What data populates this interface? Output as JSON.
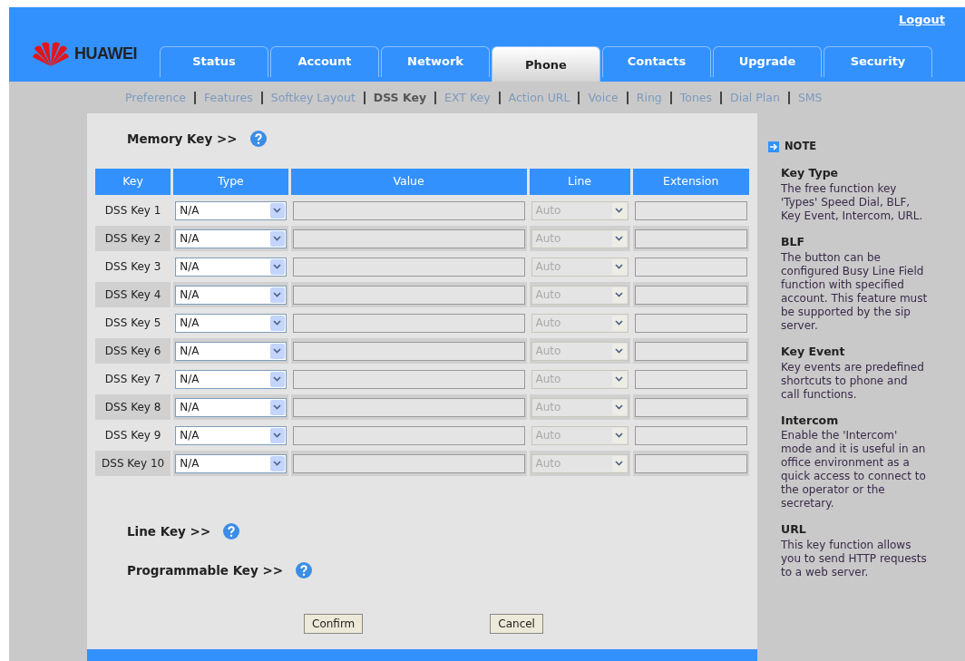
{
  "header": {
    "logo": "HUAWEI",
    "logout": "Logout"
  },
  "tabs": [
    {
      "label": "Status",
      "selected": false
    },
    {
      "label": "Account",
      "selected": false
    },
    {
      "label": "Network",
      "selected": false
    },
    {
      "label": "Phone",
      "selected": true
    },
    {
      "label": "Contacts",
      "selected": false
    },
    {
      "label": "Upgrade",
      "selected": false
    },
    {
      "label": "Security",
      "selected": false
    }
  ],
  "subnav": [
    {
      "label": "Preference",
      "selected": false
    },
    {
      "label": "Features",
      "selected": false
    },
    {
      "label": "Softkey Layout",
      "selected": false
    },
    {
      "label": "DSS Key",
      "selected": true
    },
    {
      "label": "EXT Key",
      "selected": false
    },
    {
      "label": "Action URL",
      "selected": false
    },
    {
      "label": "Voice",
      "selected": false
    },
    {
      "label": "Ring",
      "selected": false
    },
    {
      "label": "Tones",
      "selected": false
    },
    {
      "label": "Dial Plan",
      "selected": false
    },
    {
      "label": "SMS",
      "selected": false
    }
  ],
  "memory_key": {
    "title": "Memory Key >>",
    "columns": [
      "Key",
      "Type",
      "Value",
      "Line",
      "Extension"
    ],
    "rows": [
      {
        "key": "DSS Key 1",
        "type": "N/A",
        "line": "Auto",
        "line_disabled": true
      },
      {
        "key": "DSS Key 2",
        "type": "N/A",
        "line": "Auto",
        "line_disabled": true
      },
      {
        "key": "DSS Key 3",
        "type": "N/A",
        "line": "Auto",
        "line_disabled": true
      },
      {
        "key": "DSS Key 4",
        "type": "N/A",
        "line": "Auto",
        "line_disabled": true
      },
      {
        "key": "DSS Key 5",
        "type": "N/A",
        "line": "Auto",
        "line_disabled": true
      },
      {
        "key": "DSS Key 6",
        "type": "N/A",
        "line": "Auto",
        "line_disabled": true
      },
      {
        "key": "DSS Key 7",
        "type": "N/A",
        "line": "Auto",
        "line_disabled": true
      },
      {
        "key": "DSS Key 8",
        "type": "N/A",
        "line": "Auto",
        "line_disabled": true
      },
      {
        "key": "DSS Key 9",
        "type": "N/A",
        "line": "Auto",
        "line_disabled": true
      },
      {
        "key": "DSS Key 10",
        "type": "N/A",
        "line": "Auto",
        "line_disabled": true
      }
    ]
  },
  "sections": [
    {
      "title": "Line Key >>"
    },
    {
      "title": "Programmable Key >>"
    }
  ],
  "buttons": [
    "Confirm",
    "Cancel"
  ],
  "note": {
    "title": "NOTE",
    "items": [
      {
        "heading": "Key Type",
        "text": "The free function key 'Types' Speed Dial, BLF, Key Event, Intercom, URL."
      },
      {
        "heading": "BLF",
        "text": "The button can be configured Busy Line Field function with specified account. This feature must be supported by the sip server."
      },
      {
        "heading": "Key Event",
        "text": "Key events are predefined shortcuts to phone and call functions."
      },
      {
        "heading": "Intercom",
        "text": "Enable the 'Intercom' mode and it is useful in an office environment as a quick access to connect to the operator or the secretary."
      },
      {
        "heading": "URL",
        "text": "This key function allows you to send HTTP requests to a web server."
      }
    ]
  }
}
